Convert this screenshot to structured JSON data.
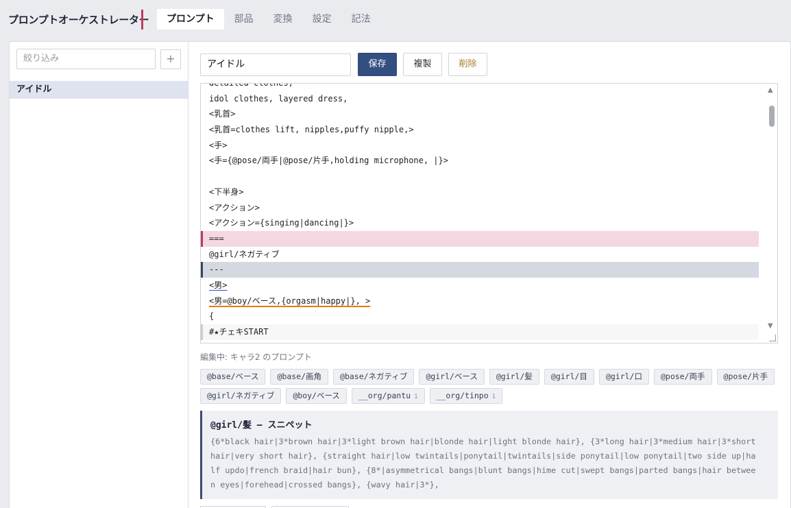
{
  "header": {
    "app_title": "プロンプトオーケストレーター",
    "tabs": [
      "プロンプト",
      "部品",
      "変換",
      "設定",
      "記法"
    ],
    "active_tab": "プロンプト"
  },
  "sidebar": {
    "filter_placeholder": "絞り込み",
    "add_label": "+",
    "items": [
      {
        "label": "アイドル",
        "selected": true
      }
    ]
  },
  "main": {
    "name_value": "アイドル",
    "save_label": "保存",
    "copy_label": "複製",
    "delete_label": "削除",
    "editor_lines": [
      "detailed clothes,",
      "idol clothes, layered dress,",
      "<乳首>",
      "<乳首=clothes lift, nipples,puffy nipple,>",
      "<手>",
      "<手={@pose/両手|@pose/片手,holding microphone, |}>",
      "",
      "<下半身>",
      "<アクション>",
      "<アクション={singing|dancing|}>",
      "===",
      "@girl/ネガティブ",
      "---",
      "<男>",
      "<男=@boy/ベース,{orgasm|happy|}, >",
      "{",
      "#★チェキSTART"
    ],
    "editing_label": "編集中: キャラ2 のプロンプト",
    "chips_row1": [
      "@base/ベース",
      "@base/画角",
      "@base/ネガティブ",
      "@girl/ベース",
      "@girl/髪",
      "@girl/目",
      "@girl/口",
      "@pose/両手",
      "@pose/片手"
    ],
    "chips_row2": [
      {
        "label": "@girl/ネガティブ",
        "count": ""
      },
      {
        "label": "@boy/ベース",
        "count": ""
      },
      {
        "label": "__org/pantu",
        "count": "1"
      },
      {
        "label": "__org/tinpo",
        "count": "1"
      }
    ],
    "snippet": {
      "title": "@girl/髪 — スニペット",
      "body": "{6*black hair|3*brown hair|3*light brown hair|blonde hair|light blonde hair}, {3*long hair|3*medium hair|3*short hair|very short hair}, {straight hair|low twintails|ponytail|twintails|side ponytail|low ponytail|two side up|half updo|french braid|hair bun}, {8*|asymmetrical bangs|blunt bangs|hime cut|swept bangs|parted bangs|hair between eyes|forehead|crossed bangs}, {wavy hair|3*},"
    }
  },
  "colors": {
    "accent": "#c23a62",
    "primary_button": "#334f80",
    "delete_text": "#a47b2c",
    "highlight_pink": "#f5d7e2",
    "highlight_gray": "#d4d8e0"
  }
}
